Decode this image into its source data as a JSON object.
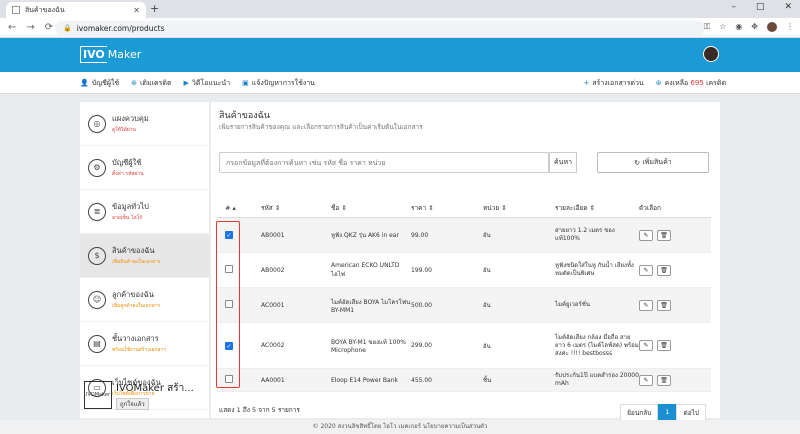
{
  "browser": {
    "tab_title": "สินค้าของฉัน",
    "url": "ivomaker.com/products"
  },
  "app": {
    "logo_box": "IVO",
    "logo_rest": "Maker"
  },
  "subnav": {
    "links": [
      "บัญชีผู้ใช้",
      "เติมเครดิต",
      "วิดีโอแนะนำ",
      "แจ้งปัญหาการใช้งาน"
    ],
    "create_doc": "สร้างเอกสารด่วน",
    "credit_label": "คงเหลือ",
    "credit_value": "695",
    "credit_unit": "เครดิต"
  },
  "sidebar": {
    "items": [
      {
        "title": "แผงควบคุม",
        "sub": "ดูให้ได้ผ่าน"
      },
      {
        "title": "บัญชีผู้ใช้",
        "sub": "ตั้งค่า รหัสผ่าน"
      },
      {
        "title": "ข้อมูลทั่วไป",
        "sub": "ลายเซ็น โลโก้"
      },
      {
        "title": "สินค้าของฉัน",
        "sub": "เพิ่มสินค้าลงในเอกสาร"
      },
      {
        "title": "ลูกค้าของฉัน",
        "sub": "เพิ่มลูกค้าลงในเอกสาร"
      },
      {
        "title": "ชั้นวางเอกสาร",
        "sub": "พร้อมใช้งานสร้างเอกสาร"
      },
      {
        "title": "เว็บไซต์ของฉัน",
        "sub": "เว็บไซต์เพื่อการขาย"
      }
    ],
    "fb_name": "IVOMaker สร้า...",
    "fb_like": "ถูกใจแล้ว",
    "fb_logo": "IVOMaker"
  },
  "page": {
    "title": "สินค้าของฉัน",
    "subtitle": "เพิ่มรายการสินค้าของคุณ และเลือกรายการสินค้าเป็นค่าเริ่มต้นในเอกสาร",
    "search_placeholder": "กรอกข้อมูลที่ต้องการค้นหา เช่น รหัส ชื่อ ราคา หน่วย",
    "search_btn": "ค้นหา",
    "add_btn": "เพิ่มสินค้า"
  },
  "table": {
    "headers": [
      "#",
      "รหัส",
      "ชื่อ",
      "ราคา",
      "หน่วย",
      "รายละเอียด",
      "ตัวเลือก"
    ],
    "rows": [
      {
        "checked": true,
        "code": "AB0001",
        "name": "หูฟัง QKZ รุ่น AK6 in ear",
        "price": "99.00",
        "unit": "อัน",
        "detail": "สายยาว 1.2 เมตร ของแท้100%"
      },
      {
        "checked": false,
        "code": "AB0002",
        "name": "American ECKO UNLTD ไฮไฟ",
        "price": "199.00",
        "unit": "อัน",
        "detail": "หูฟังชนิดใส่ในหู กันน้ำ เสียงทั้งหมดัดเป็นพิเศษ"
      },
      {
        "checked": false,
        "code": "AC0001",
        "name": "ไมค์อัดเสียง BOYA ไมโครโฟน BY-MM1",
        "price": "500.00",
        "unit": "อัน",
        "detail": "ไมค์ยูเวอร์ชั่น"
      },
      {
        "checked": true,
        "code": "AC0002",
        "name": "BOYA BY-M1 ของแท้ 100% Microphone",
        "price": "299.00",
        "unit": "อัน",
        "detail": "ไมค์อัดเสียง กล้อง มือถือ สายยาว 6 เมตร (ไมค์ไลฟ์สด) พร้อมส่งค่ะ !!!! bestbosss"
      },
      {
        "checked": false,
        "code": "AA0001",
        "name": "Eloop E14 Power Bank",
        "price": "455.00",
        "unit": "ชิ้น",
        "detail": "รับประกัน1ปี แบตสำรอง 20000 mAh"
      }
    ]
  },
  "pagination": {
    "info": "แสดง 1 ถึง 5 จาก 5 รายการ",
    "prev": "ย้อนกลับ",
    "current": "1",
    "next": "ต่อไป"
  },
  "footer": {
    "text": "© 2020 สงวนลิขสิทธิ์โดย ไอโว เมคเกอร์ นโยบายความเป็นส่วนตัว"
  }
}
